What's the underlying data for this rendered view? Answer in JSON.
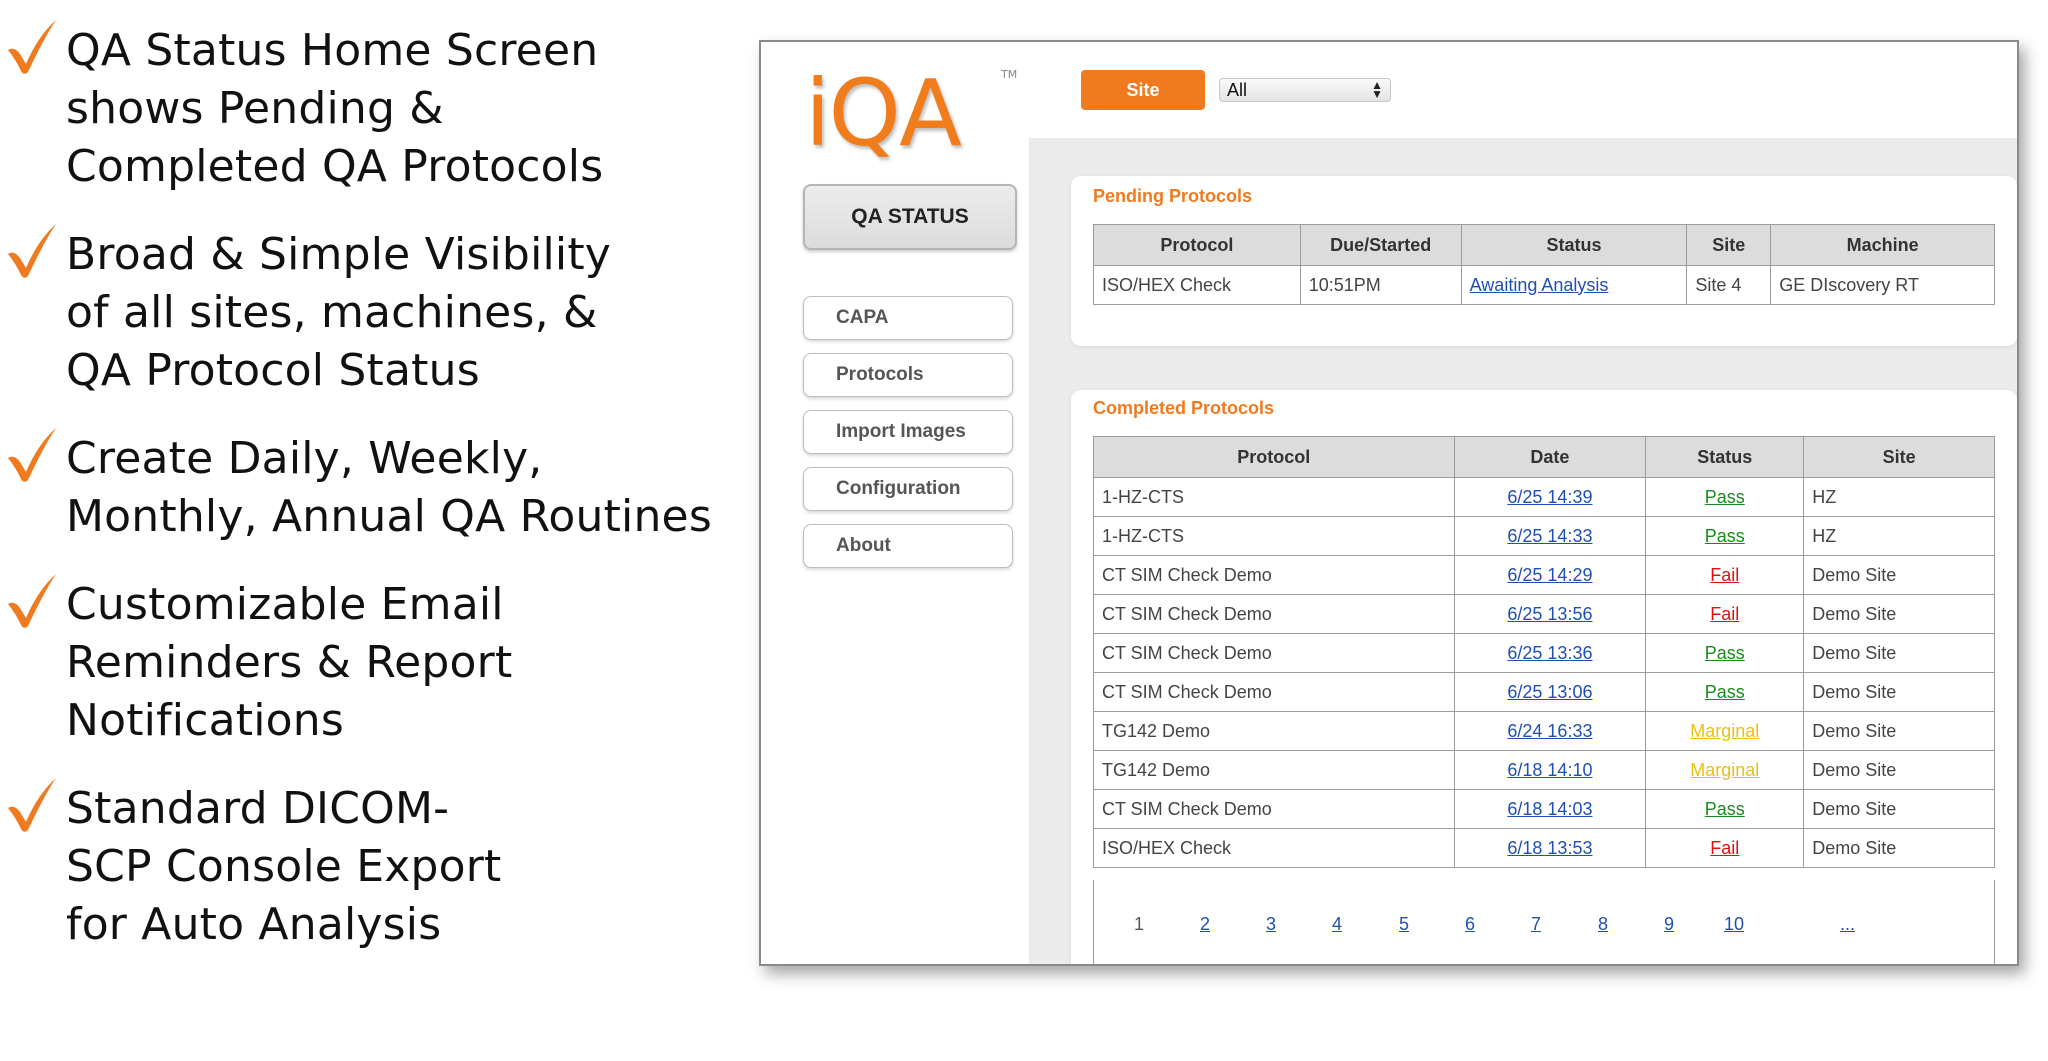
{
  "features": [
    {
      "lines": [
        "QA Status Home Screen",
        "shows Pending &",
        "Completed QA Protocols"
      ]
    },
    {
      "lines": [
        "Broad & Simple Visibility",
        "of all sites, machines, &",
        "QA Protocol Status"
      ]
    },
    {
      "lines": [
        "Create Daily, Weekly,",
        "Monthly, Annual QA Routines"
      ]
    },
    {
      "lines": [
        "Customizable Email",
        "Reminders & Report",
        "Notifications"
      ]
    },
    {
      "lines": [
        "Standard DICOM-",
        "SCP Console Export",
        "for Auto Analysis"
      ]
    }
  ],
  "colors": {
    "accent": "#f07a20",
    "check": "#f07a20",
    "pass": "#1a8a1a",
    "fail": "#e01010",
    "marginal": "#e8c010",
    "link": "#1f4fb0"
  },
  "app": {
    "logo": "iQA",
    "logo_tm": "TM",
    "sidebar": {
      "qa_status": "QA STATUS",
      "items": [
        "CAPA",
        "Protocols",
        "Import Images",
        "Configuration",
        "About"
      ]
    },
    "topbar": {
      "site_button": "Site",
      "site_select_value": "All"
    },
    "pending": {
      "title": "Pending Protocols",
      "columns": [
        "Protocol",
        "Due/Started",
        "Status",
        "Site",
        "Machine"
      ],
      "rows": [
        {
          "protocol": "ISO/HEX Check",
          "due": "10:51PM",
          "status": "Awaiting Analysis",
          "site": "Site 4",
          "machine": "GE DIscovery RT"
        }
      ]
    },
    "completed": {
      "title": "Completed Protocols",
      "columns": [
        "Protocol",
        "Date",
        "Status",
        "Site"
      ],
      "rows": [
        {
          "protocol": "1-HZ-CTS",
          "date": "6/25 14:39",
          "status": "Pass",
          "site": "HZ"
        },
        {
          "protocol": "1-HZ-CTS",
          "date": "6/25 14:33",
          "status": "Pass",
          "site": "HZ"
        },
        {
          "protocol": "CT SIM Check Demo",
          "date": "6/25 14:29",
          "status": "Fail",
          "site": "Demo Site"
        },
        {
          "protocol": "CT SIM Check Demo",
          "date": "6/25 13:56",
          "status": "Fail",
          "site": "Demo Site"
        },
        {
          "protocol": "CT SIM Check Demo",
          "date": "6/25 13:36",
          "status": "Pass",
          "site": "Demo Site"
        },
        {
          "protocol": "CT SIM Check Demo",
          "date": "6/25 13:06",
          "status": "Pass",
          "site": "Demo Site"
        },
        {
          "protocol": "TG142 Demo",
          "date": "6/24 16:33",
          "status": "Marginal",
          "site": "Demo Site"
        },
        {
          "protocol": "TG142 Demo",
          "date": "6/18 14:10",
          "status": "Marginal",
          "site": "Demo Site"
        },
        {
          "protocol": "CT SIM Check Demo",
          "date": "6/18 14:03",
          "status": "Pass",
          "site": "Demo Site"
        },
        {
          "protocol": "ISO/HEX Check",
          "date": "6/18 13:53",
          "status": "Fail",
          "site": "Demo Site"
        }
      ],
      "pages": [
        "1",
        "2",
        "3",
        "4",
        "5",
        "6",
        "7",
        "8",
        "9",
        "10",
        "..."
      ],
      "current_page": "1"
    }
  }
}
